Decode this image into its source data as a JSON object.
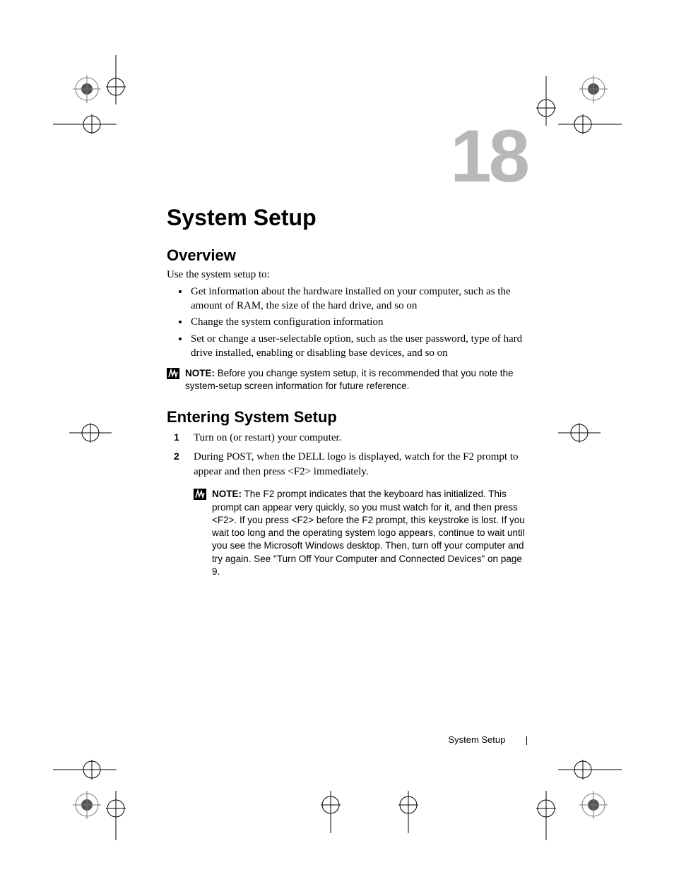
{
  "chapter": {
    "number": "18",
    "title": "System Setup"
  },
  "overview": {
    "heading": "Overview",
    "intro": "Use the system setup to:",
    "bullets": [
      "Get information about the hardware installed on your computer, such as the amount of RAM, the size of the hard drive, and so on",
      "Change the system configuration information",
      "Set or change a user-selectable option, such as the user password, type of hard drive installed, enabling or disabling base devices, and so on"
    ],
    "note_label": "NOTE:",
    "note_text": "Before you change system setup, it is recommended that you note the system-setup screen information for future reference."
  },
  "entering": {
    "heading": "Entering System Setup",
    "steps": [
      "Turn on (or restart) your computer.",
      "During POST, when the DELL logo is displayed, watch for the F2 prompt to appear and then press <F2> immediately."
    ],
    "note_label": "NOTE:",
    "note_text": "The F2 prompt indicates that the keyboard has initialized. This prompt can appear very quickly, so you must watch for it, and then press <F2>. If you press <F2> before the F2 prompt, this keystroke is lost. If you wait too long and the operating system logo appears, continue to wait until you see the Microsoft Windows desktop. Then, turn off your computer and try again. See \"Turn Off Your Computer and Connected Devices\" on page 9."
  },
  "footer": {
    "running_head": "System Setup"
  }
}
